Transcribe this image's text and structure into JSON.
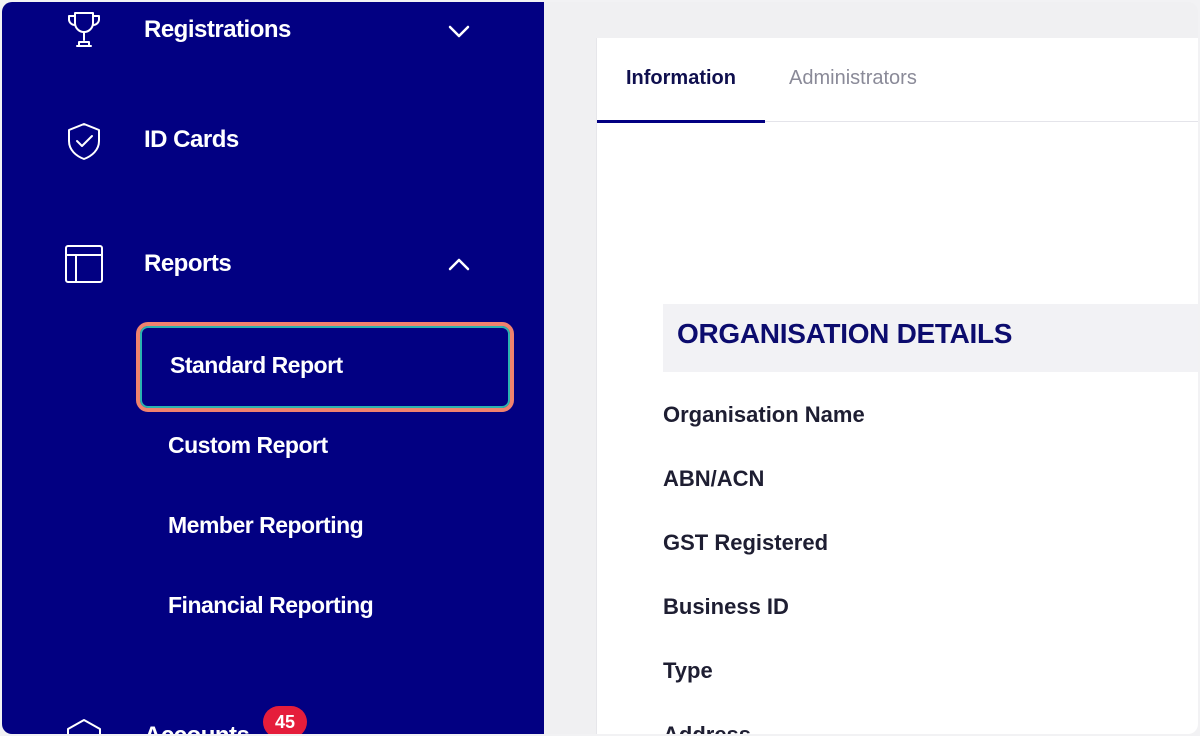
{
  "sidebar": {
    "items": [
      {
        "label": "Registrations",
        "icon": "trophy-icon",
        "chevron": "down"
      },
      {
        "label": "ID Cards",
        "icon": "shield-check-icon"
      },
      {
        "label": "Reports",
        "icon": "layout-icon",
        "chevron": "up"
      }
    ],
    "sub_items": [
      {
        "label": "Standard Report",
        "active": true
      },
      {
        "label": "Custom Report"
      },
      {
        "label": "Member Reporting"
      },
      {
        "label": "Financial Reporting"
      }
    ],
    "next_item": {
      "label": "Accounts",
      "badge": "45"
    }
  },
  "tabs": [
    {
      "label": "Information",
      "active": true
    },
    {
      "label": "Administrators"
    }
  ],
  "section": {
    "title": "ORGANISATION DETAILS",
    "fields": [
      "Organisation Name",
      "ABN/ACN",
      "GST Registered",
      "Business ID",
      "Type",
      "Address"
    ]
  },
  "colors": {
    "sidebar_bg": "#020082",
    "active_outline": "#f0826e",
    "badge_bg": "#e51d3b"
  }
}
